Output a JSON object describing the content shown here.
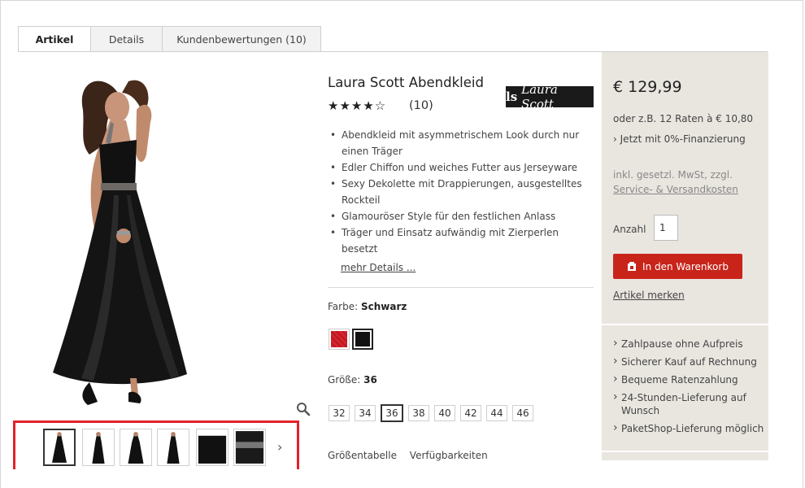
{
  "tabs": [
    {
      "label": "Artikel",
      "active": true
    },
    {
      "label": "Details",
      "active": false
    },
    {
      "label": "Kundenbewertungen (10)",
      "active": false
    }
  ],
  "product": {
    "title": "Laura Scott Abendkleid",
    "stars": "★★★★☆",
    "rating_count": "(10)",
    "brand": "Laura Scott",
    "features": [
      "Abendkleid mit asymmetrischem Look durch nur einen Träger",
      "Edler Chiffon und weiches Futter aus Jerseyware",
      "Sexy Dekolette mit Drappierungen, ausgestelltes Rockteil",
      "Glamouröser Style für den festlichen Anlass",
      "Träger und Einsatz aufwändig mit Zierperlen besetzt"
    ],
    "more_details": "mehr Details ...",
    "color_label": "Farbe:",
    "color_value": "Schwarz",
    "swatches": [
      {
        "name": "Rot",
        "color": "#d9232d",
        "selected": false
      },
      {
        "name": "Schwarz",
        "color": "#111111",
        "selected": true
      }
    ],
    "size_label": "Größe:",
    "size_value": "36",
    "sizes": [
      "32",
      "34",
      "36",
      "38",
      "40",
      "42",
      "44",
      "46"
    ],
    "selected_size": "36",
    "bottom_links": [
      "Größentabelle",
      "Verfügbarkeiten"
    ]
  },
  "thumbnails": {
    "count": 6,
    "next_icon": "chevron-right-icon",
    "next_glyph": "›"
  },
  "buybox": {
    "price": "€ 129,99",
    "installments": "oder z.B. 12 Raten à € 10,80",
    "financing": "Jetzt mit 0%-Finanzierung",
    "tax_note": "inkl. gesetzl. MwSt, zzgl.",
    "service_link": "Service- & Versandkosten",
    "quantity_label": "Anzahl",
    "quantity_value": "1",
    "cart_button": "In den Warenkorb",
    "remember_link": "Artikel merken",
    "benefits": [
      "Zahlpause ohne Aufpreis",
      "Sicherer Kauf auf Rechnung",
      "Bequeme Ratenzahlung",
      "24-Stunden-Lieferung auf Wunsch",
      "PaketShop-Lieferung möglich"
    ],
    "accent_color": "#c8241a",
    "panel_color": "#e9e6e0"
  },
  "icons": {
    "zoom": "magnifier-icon",
    "cart": "cart-icon"
  }
}
